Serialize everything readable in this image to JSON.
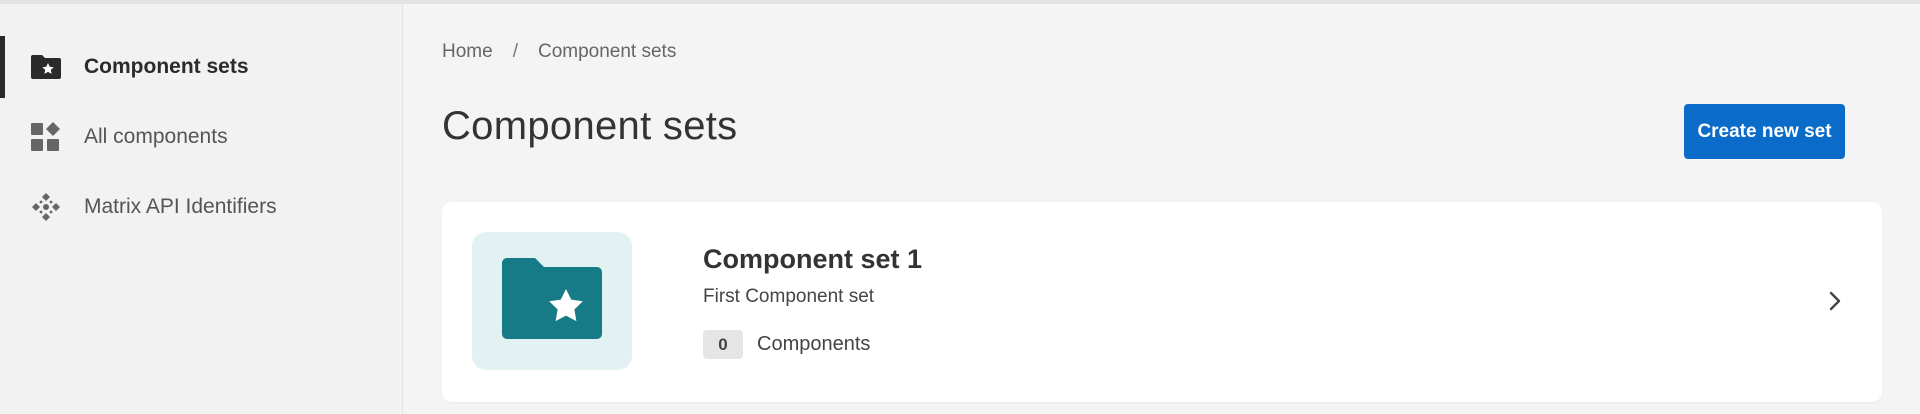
{
  "sidebar": {
    "items": [
      {
        "label": "Component sets",
        "icon": "folder-star-icon",
        "active": true
      },
      {
        "label": "All components",
        "icon": "components-grid-icon",
        "active": false
      },
      {
        "label": "Matrix API Identifiers",
        "icon": "api-nodes-icon",
        "active": false
      }
    ]
  },
  "breadcrumb": {
    "home": "Home",
    "separator": "/",
    "current": "Component sets"
  },
  "page": {
    "title": "Component sets",
    "create_button": "Create new set"
  },
  "sets": [
    {
      "title": "Component set 1",
      "description": "First Component set",
      "count": "0",
      "count_label": "Components",
      "icon": "folder-star-icon"
    }
  ],
  "colors": {
    "primary": "#0a6bc9",
    "thumb_bg": "#e2f1f2",
    "folder": "#167b87",
    "sidebar_bg": "#f2f2f2",
    "page_bg": "#f4f4f4"
  }
}
